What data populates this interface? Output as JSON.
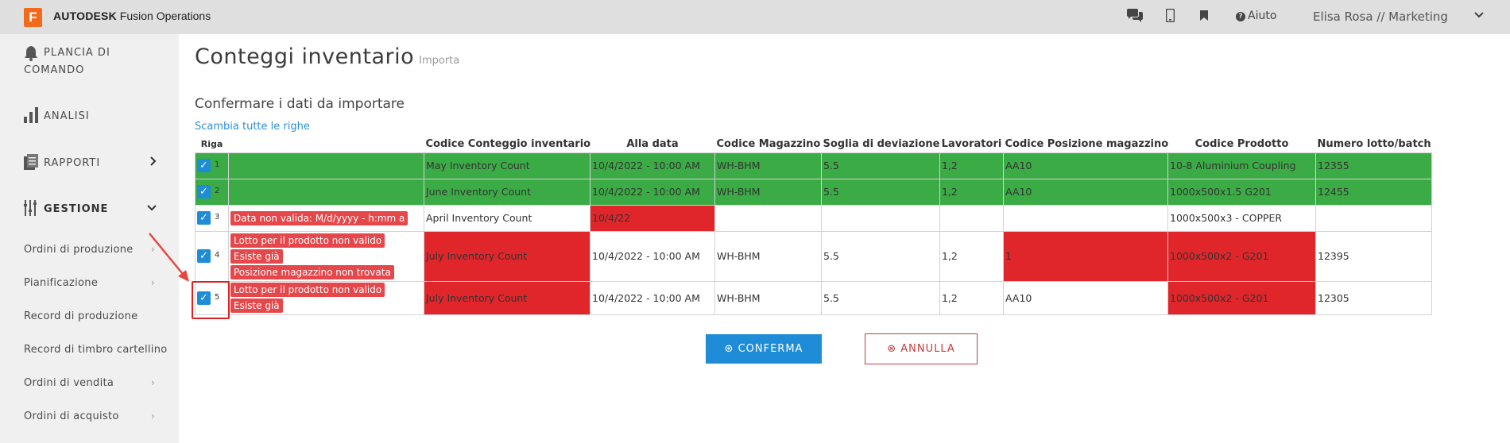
{
  "header": {
    "logo_letter": "F",
    "brand_bold": "AUTODESK",
    "brand_rest": "Fusion Operations",
    "help_label": "Aiuto",
    "user_label": "Elisa Rosa // Marketing"
  },
  "sidebar": {
    "dashboard_line1": "PLANCIA DI",
    "dashboard_line2": "COMANDO",
    "analysis": "ANALISI",
    "reports": "RAPPORTI",
    "management": "GESTIONE",
    "sub_items": [
      "Ordini di produzione",
      "Pianificazione",
      "Record di produzione",
      "Record di timbro cartellino",
      "Ordini di vendita",
      "Ordini di acquisto"
    ]
  },
  "page": {
    "title": "Conteggi inventario",
    "title_sub": "Importa",
    "subtitle": "Confermare i dati da importare",
    "swap_link": "Scambia tutte le righe"
  },
  "table": {
    "headers": [
      "Riga",
      "",
      "Codice Conteggio inventario",
      "Alla data",
      "Codice Magazzino",
      "Soglia di deviazione",
      "Lavoratori",
      "Codice Posizione magazzino",
      "Codice Prodotto",
      "Numero lotto/batch"
    ],
    "rows": [
      {
        "num": "1",
        "errors": [],
        "cells": [
          "May Inventory Count",
          "10/4/2022 - 10:00 AM",
          "WH-BHM",
          "5.5",
          "1,2",
          "AA10",
          "10-8 Aluminium Coupling",
          "12355"
        ]
      },
      {
        "num": "2",
        "errors": [],
        "cells": [
          "June Inventory Count",
          "10/4/2022 - 10:00 AM",
          "WH-BHM",
          "5.5",
          "1,2",
          "AA10",
          "1000x500x1.5 G201",
          "12455"
        ]
      },
      {
        "num": "3",
        "errors": [
          "Data non valida: M/d/yyyy - h:mm a"
        ],
        "cells": [
          "April Inventory Count",
          "10/4/22",
          "",
          "",
          "",
          "",
          "1000x500x3 - COPPER",
          ""
        ]
      },
      {
        "num": "4",
        "errors": [
          "Lotto per il prodotto non valido",
          "Esiste già",
          "Posizione magazzino non trovata"
        ],
        "cells": [
          "July Inventory Count",
          "10/4/2022 - 10:00 AM",
          "WH-BHM",
          "5.5",
          "1,2",
          "1",
          "1000x500x2 - G201",
          "12395"
        ]
      },
      {
        "num": "5",
        "errors": [
          "Lotto per il prodotto non valido",
          "Esiste già"
        ],
        "cells": [
          "July Inventory Count",
          "10/4/2022 - 10:00 AM",
          "WH-BHM",
          "5.5",
          "1,2",
          "AA10",
          "1000x500x2 - G201",
          "12305"
        ]
      }
    ]
  },
  "buttons": {
    "confirm": "CONFERMA",
    "cancel": "ANNULLA"
  },
  "colors": {
    "ok_row": "#3bab45",
    "error_cell": "#e0262a",
    "accent": "#1f8cd8",
    "brand": "#f26b1d"
  }
}
